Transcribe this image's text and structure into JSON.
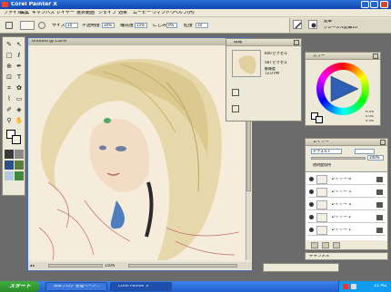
{
  "window": {
    "title": "Corel Painter X"
  },
  "menu": [
    "ファイル",
    "編集",
    "キャンバス",
    "レイヤー",
    "選択範囲",
    "シェイプ",
    "効果",
    "ムービー",
    "ウィンドウ",
    "ヘルプ(H)"
  ],
  "propbar": {
    "size_label": "サイズ",
    "size_value": "14",
    "opacity_label": "不透明度",
    "opacity_value": "34%",
    "resat_label": "補充度",
    "resat_value": "15%",
    "bleed_label": "にじみ",
    "bleed_value": "0%",
    "jitter_label": "粒度",
    "jitter_value": "10",
    "brush_category": "鉛筆",
    "brush_variant": "グレースル鉛筆10"
  },
  "canvas": {
    "title": "Untitled @ 150%",
    "zoom": "150%"
  },
  "info_panel": {
    "title": "情報",
    "width_label": "600 ピクセル",
    "height_label": "587 ピクセル",
    "res_label": "解像度",
    "res_value": "72.0 PPI"
  },
  "color_panel": {
    "title": "カラー",
    "h": "H 0%",
    "s": "S 0%",
    "v": "V 0%"
  },
  "layers_panel": {
    "title": "レイヤー",
    "composite": "デフォルト",
    "opacity": "100%",
    "option": "透明度保持",
    "layers": [
      "レイヤー 6",
      "レイヤー 5",
      "レイヤー 3",
      "レイヤー 2",
      "レイヤー 1"
    ]
  },
  "channels_label": "チャンネル",
  "taskbar": {
    "start": "スタート",
    "items": [
      "日本ブログ 管理ページ…",
      "Corel Painter X"
    ],
    "clock": "21:42"
  },
  "colors": {
    "accent": "#1f5ecf",
    "panel": "#ece9d8",
    "canvas_bg": "#f6ecdc"
  }
}
